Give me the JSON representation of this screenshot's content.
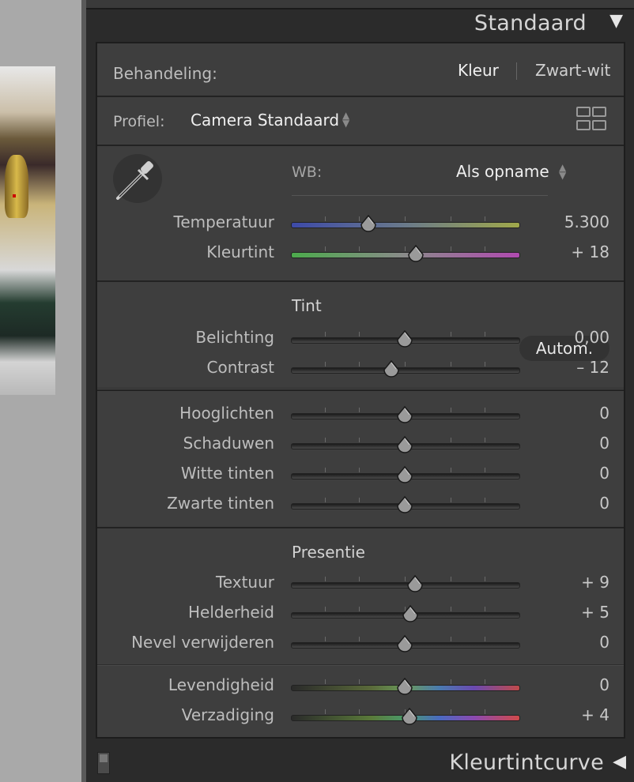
{
  "panel": {
    "preset_title": "Standaard",
    "footer_title": "Kleurtintcurve"
  },
  "treatment": {
    "label": "Behandeling:",
    "color": "Kleur",
    "bw": "Zwart-wit"
  },
  "profile": {
    "label": "Profiel:",
    "value": "Camera Standaard"
  },
  "wb": {
    "label": "WB:",
    "value": "Als opname"
  },
  "sliders": {
    "temperatuur": {
      "label": "Temperatuur",
      "value": "5.300",
      "pos": 0.34
    },
    "kleurtint": {
      "label": "Kleurtint",
      "value": "+ 18",
      "pos": 0.55
    },
    "belichting": {
      "label": "Belichting",
      "value": "0,00",
      "pos": 0.5
    },
    "contrast": {
      "label": "Contrast",
      "value": "– 12",
      "pos": 0.44
    },
    "hooglichten": {
      "label": "Hooglichten",
      "value": "0",
      "pos": 0.5
    },
    "schaduwen": {
      "label": "Schaduwen",
      "value": "0",
      "pos": 0.5
    },
    "witte": {
      "label": "Witte tinten",
      "value": "0",
      "pos": 0.5
    },
    "zwarte": {
      "label": "Zwarte tinten",
      "value": "0",
      "pos": 0.5
    },
    "textuur": {
      "label": "Textuur",
      "value": "+ 9",
      "pos": 0.545
    },
    "helderheid": {
      "label": "Helderheid",
      "value": "+ 5",
      "pos": 0.525
    },
    "nevel": {
      "label": "Nevel verwijderen",
      "value": "0",
      "pos": 0.5
    },
    "levendigheid": {
      "label": "Levendigheid",
      "value": "0",
      "pos": 0.5
    },
    "verzadiging": {
      "label": "Verzadiging",
      "value": "+ 4",
      "pos": 0.52
    }
  },
  "tone": {
    "title": "Tint",
    "auto": "Autom."
  },
  "presence": {
    "title": "Presentie"
  },
  "colors": {
    "panel_bg": "#3e3e3e",
    "temp_gradient": [
      "#3d4aa8",
      "#a0a84a"
    ],
    "tint_gradient": [
      "#4caa4c",
      "#b04ab0"
    ]
  }
}
